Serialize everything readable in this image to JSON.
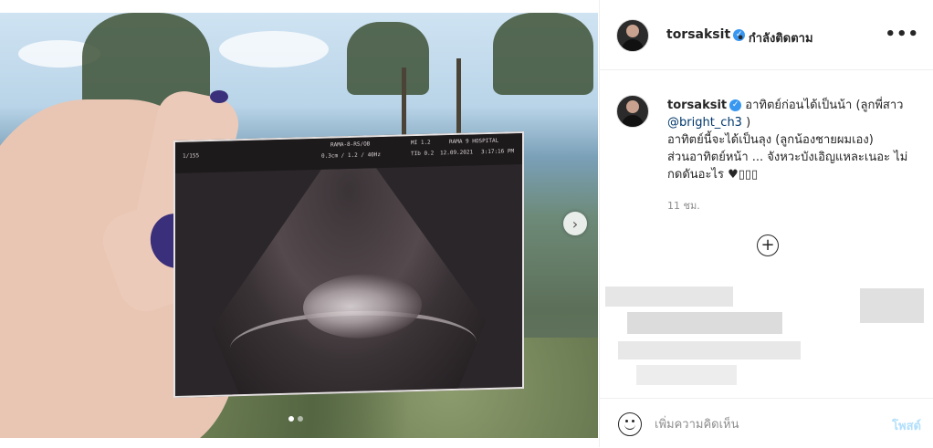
{
  "author": {
    "username": "torsaksit",
    "verified": true,
    "follow_status": "• กำลังติดตาม"
  },
  "menu_label": "•••",
  "media": {
    "scan": {
      "hospital": "RAMA 9 HOSPITAL",
      "probe": "RAMA-8-RS/OB",
      "mi": "MI 1.2",
      "tib": "TIb 0.2",
      "date": "12.09.2021",
      "time": "3:17:16 PM",
      "depth": "0.3cm / 1.2 / 40Hz",
      "side": "1/155"
    },
    "carousel_next": "›",
    "page_count": 2,
    "active_page": 1
  },
  "caption": {
    "username": "torsaksit",
    "text_before_mention": "อาทิตย์ก่อนได้เป็นน้า (ลูกพี่สาว ",
    "mention": "@bright_ch3",
    "text_after_mention": " )",
    "line2": "อาทิตย์นี้จะได้เป็นลุง (ลูกน้องชายผมเอง)",
    "line3": "ส่วนอาทิตย์หน้า ... จังหวะบังเอิญแหละเนอะ ไม่กดดันอะไร ♥▯▯▯"
  },
  "timestamp": "11 ชม.",
  "load_more": "+",
  "comment": {
    "placeholder": "เพิ่มความคิดเห็น",
    "post_label": "โพสต์"
  },
  "colors": {
    "verified": "#3897f0",
    "mention": "#00376b",
    "post_disabled": "#b2dffc",
    "muted": "#8e8e8e"
  }
}
